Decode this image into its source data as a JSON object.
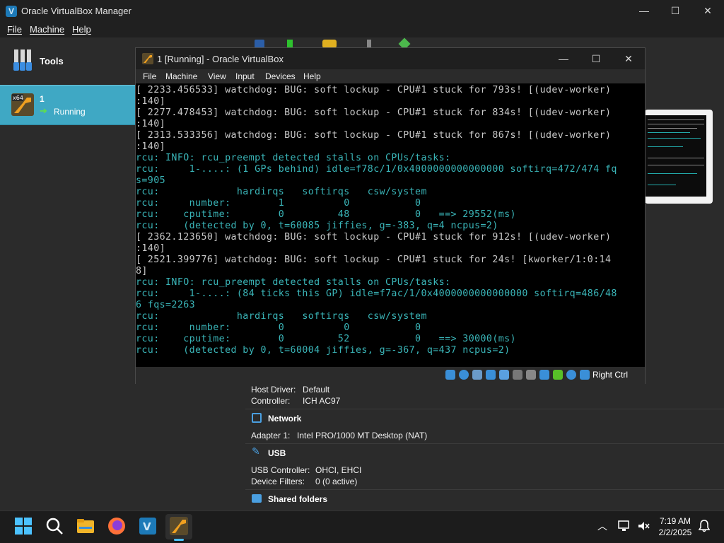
{
  "manager": {
    "title": "Oracle VirtualBox Manager",
    "menu": [
      "File",
      "Machine",
      "Help"
    ],
    "controls": {
      "minimize": "—",
      "maximize": "☐",
      "close": "✕"
    },
    "sidebar": {
      "tools_label": "Tools",
      "vm": {
        "name": "1",
        "state": "Running",
        "badge": "x64"
      }
    },
    "details": {
      "audio": [
        {
          "label": "Host Driver:",
          "value": "Default"
        },
        {
          "label": "Controller:",
          "value": "ICH AC97"
        }
      ],
      "network": {
        "header": "Network",
        "rows": [
          {
            "label": "Adapter 1:",
            "value": "Intel PRO/1000 MT Desktop (NAT)"
          }
        ]
      },
      "usb": {
        "header": "USB",
        "rows": [
          {
            "label": "USB Controller:",
            "value": "OHCI, EHCI"
          },
          {
            "label": "Device Filters:",
            "value": "0 (0 active)"
          }
        ]
      },
      "shared": {
        "header": "Shared folders"
      }
    }
  },
  "vm_window": {
    "title": "1 [Running] - Oracle VirtualBox",
    "menu": [
      "File",
      "Machine",
      "View",
      "Input",
      "Devices",
      "Help"
    ],
    "controls": {
      "minimize": "—",
      "maximize": "☐",
      "close": "✕"
    },
    "host_key": "Right Ctrl",
    "console": [
      {
        "t": "[ 2233.456533] watchdog: BUG: soft lockup - CPU#1 stuck for 793s! [(udev-worker)",
        "c": "w"
      },
      {
        "t": ":140]",
        "c": "w"
      },
      {
        "t": "[ 2277.478453] watchdog: BUG: soft lockup - CPU#1 stuck for 834s! [(udev-worker)",
        "c": "w"
      },
      {
        "t": ":140]",
        "c": "w"
      },
      {
        "t": "[ 2313.533356] watchdog: BUG: soft lockup - CPU#1 stuck for 867s! [(udev-worker)",
        "c": "w"
      },
      {
        "t": ":140]",
        "c": "w"
      },
      {
        "t": "rcu: INFO: rcu_preempt detected stalls on CPUs/tasks:",
        "c": "c"
      },
      {
        "t": "rcu:     1-....: (1 GPs behind) idle=f78c/1/0x4000000000000000 softirq=472/474 fq",
        "c": "c"
      },
      {
        "t": "s=905",
        "c": "c"
      },
      {
        "t": "rcu:             hardirqs   softirqs   csw/system",
        "c": "c"
      },
      {
        "t": "rcu:     number:        1          0           0",
        "c": "c"
      },
      {
        "t": "rcu:    cputime:        0         48           0   ==> 29552(ms)",
        "c": "c"
      },
      {
        "t": "rcu:    (detected by 0, t=60085 jiffies, g=-383, q=4 ncpus=2)",
        "c": "c"
      },
      {
        "t": "[ 2362.123650] watchdog: BUG: soft lockup - CPU#1 stuck for 912s! [(udev-worker)",
        "c": "w"
      },
      {
        "t": ":140]",
        "c": "w"
      },
      {
        "t": "[ 2521.399776] watchdog: BUG: soft lockup - CPU#1 stuck for 24s! [kworker/1:0:14",
        "c": "w"
      },
      {
        "t": "8]",
        "c": "w"
      },
      {
        "t": "rcu: INFO: rcu_preempt detected stalls on CPUs/tasks:",
        "c": "c"
      },
      {
        "t": "rcu:     1-....: (84 ticks this GP) idle=f7ac/1/0x4000000000000000 softirq=486/48",
        "c": "c"
      },
      {
        "t": "6 fqs=2263",
        "c": "c"
      },
      {
        "t": "rcu:             hardirqs   softirqs   csw/system",
        "c": "c"
      },
      {
        "t": "rcu:     number:        0          0           0",
        "c": "c"
      },
      {
        "t": "rcu:    cputime:        0         52           0   ==> 30000(ms)",
        "c": "c"
      },
      {
        "t": "rcu:    (detected by 0, t=60004 jiffies, g=-367, q=437 ncpus=2)",
        "c": "c"
      }
    ]
  },
  "taskbar": {
    "time": "7:19 AM",
    "date": "2/2/2025",
    "icons": [
      "windows-start-icon",
      "search-icon",
      "file-explorer-icon",
      "firefox-icon",
      "virtualbox-icon",
      "vm-1-icon"
    ]
  }
}
